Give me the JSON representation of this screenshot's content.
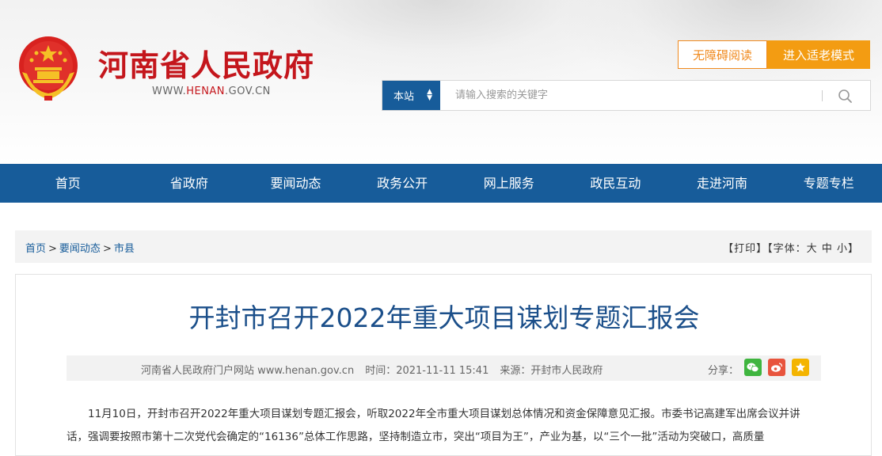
{
  "header": {
    "site_title": "河南省人民政府",
    "site_url_prefix": "WWW.",
    "site_url_highlight": "HENAN",
    "site_url_suffix": ".GOV.CN",
    "accessibility_label": "无障碍阅读",
    "elder_mode_label": "进入适老模式"
  },
  "search": {
    "scope_label": "本站",
    "placeholder": "请输入搜索的关键字"
  },
  "nav": {
    "items": [
      "首页",
      "省政府",
      "要闻动态",
      "政务公开",
      "网上服务",
      "政民互动",
      "走进河南",
      "专题专栏"
    ]
  },
  "breadcrumb": {
    "items": [
      "首页",
      "要闻动态",
      "市县"
    ],
    "separator": ">",
    "print_label": "【打印】",
    "font_label_prefix": "【字体：",
    "font_large": "大",
    "font_medium": "中",
    "font_small": "小",
    "font_label_suffix": "】"
  },
  "article": {
    "title": "开封市召开2022年重大项目谋划专题汇报会",
    "publisher": "河南省人民政府门户网站 www.henan.gov.cn",
    "time": "时间：2021-11-11 15:41",
    "source": "来源：开封市人民政府",
    "share_label": "分享：",
    "body": "11月10日，开封市召开2022年重大项目谋划专题汇报会，听取2022年全市重大项目谋划总体情况和资金保障意见汇报。市委书记高建军出席会议并讲话，强调要按照市第十二次党代会确定的“16136”总体工作思路，坚持制造立市，突出“项目为王”，产业为基，以“三个一批”活动为突破口，高质量"
  },
  "colors": {
    "brand_red": "#c4161c",
    "nav_blue": "#175c9a",
    "accent_orange": "#f39c12",
    "title_blue": "#1b4f8a"
  },
  "icons": {
    "search": "search-icon",
    "wechat": "wechat-icon",
    "weibo": "weibo-icon",
    "favorite": "star-icon"
  }
}
